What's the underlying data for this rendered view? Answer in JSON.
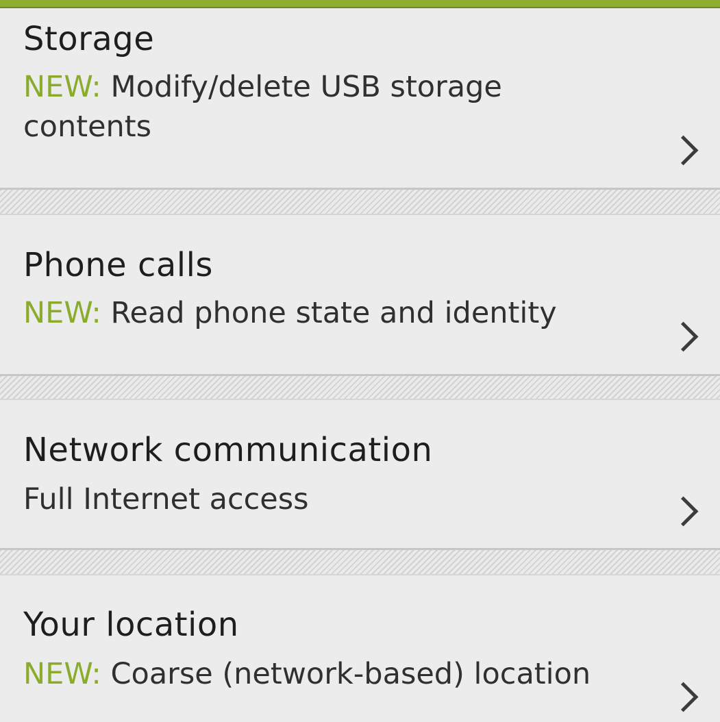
{
  "colors": {
    "accent_bar": "#8fae2e",
    "new_label": "#8aab2c",
    "background": "#ececec",
    "title_text": "#1e1e1e",
    "chevron": "#3c3c3c"
  },
  "permissions": [
    {
      "title": "Storage",
      "new_prefix": "NEW:",
      "description": "Modify/delete USB storage contents",
      "icon": "chevron-right-icon"
    },
    {
      "title": "Phone calls",
      "new_prefix": "NEW:",
      "description": "Read phone state and identity",
      "icon": "chevron-right-icon"
    },
    {
      "title": "Network communication",
      "new_prefix": "",
      "description": "Full Internet access",
      "icon": "chevron-right-icon"
    },
    {
      "title": "Your location",
      "new_prefix": "NEW:",
      "description": "Coarse (network-based) location",
      "icon": "chevron-right-icon"
    }
  ]
}
